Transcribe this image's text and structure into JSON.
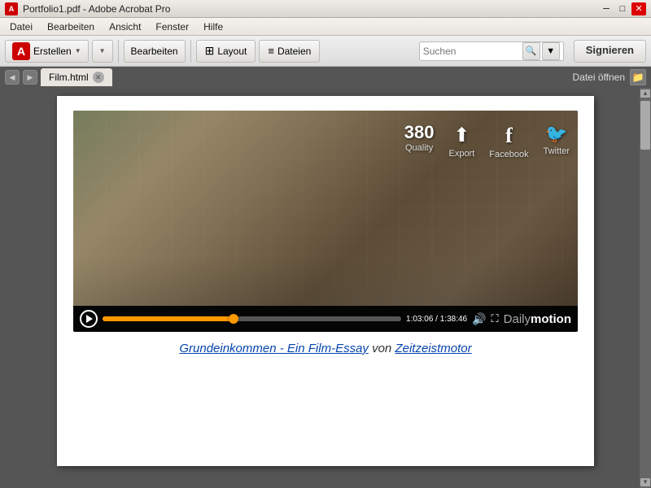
{
  "window": {
    "title": "Portfolio1.pdf - Adobe Acrobat Pro",
    "icon": "A"
  },
  "titlebar": {
    "title": "Portfolio1.pdf - Adobe Acrobat Pro",
    "min_label": "─",
    "max_label": "□",
    "close_label": "✕"
  },
  "menubar": {
    "items": [
      "Datei",
      "Bearbeiten",
      "Ansicht",
      "Fenster",
      "Hilfe"
    ]
  },
  "toolbar": {
    "erstellen_label": "Erstellen",
    "dropdown_arrow": "▼",
    "bearbeiten_label": "Bearbeiten",
    "layout_label": "Layout",
    "dateien_label": "Dateien",
    "search_placeholder": "Suchen",
    "signieren_label": "Signieren"
  },
  "tabbar": {
    "tab_label": "Film.html",
    "open_file_label": "Datei öffnen",
    "nav_prev": "◀",
    "nav_next": "▶"
  },
  "video": {
    "quality_number": "380",
    "quality_label": "Quality",
    "export_label": "Export",
    "facebook_label": "Facebook",
    "twitter_label": "Twitter",
    "export_icon": "⬆",
    "facebook_icon": "f",
    "twitter_icon": "t",
    "time_display": "1:03:06 / 1:38:46",
    "dailymotion": "Dailymotion"
  },
  "caption": {
    "link_text": "Grundeinkommen - Ein Film-Essay",
    "von_text": " von ",
    "link2_text": "Zeitzeistmotor"
  }
}
